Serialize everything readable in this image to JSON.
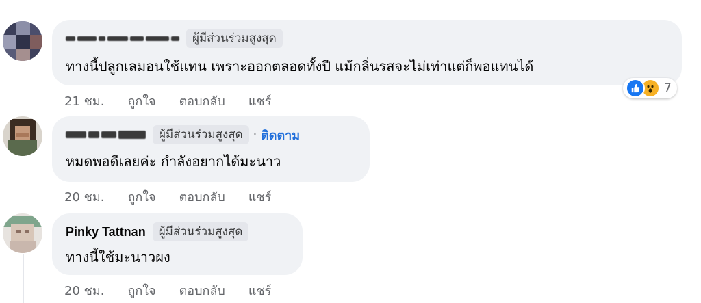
{
  "comments": [
    {
      "author_redacted": true,
      "badge": "ผู้มีส่วนร่วมสูงสุด",
      "text": "ทางนี้ปลูกเลมอนใช้แทน เพราะออกตลอดทั้งปี แม้กลิ่นรสจะไม่เท่าแต่ก็พอแทนได้",
      "time": "21 ชม.",
      "like": "ถูกใจ",
      "reply": "ตอบกลับ",
      "share": "แชร์",
      "reactions": {
        "icons": [
          "like-icon",
          "wow-icon"
        ],
        "count": "7"
      }
    },
    {
      "author_redacted": true,
      "badge": "ผู้มีส่วนร่วมสูงสุด",
      "separator": "·",
      "follow": "ติดตาม",
      "text": "หมดพอดีเลยค่ะ กำลังอยากได้มะนาว",
      "time": "20 ชม.",
      "like": "ถูกใจ",
      "reply": "ตอบกลับ",
      "share": "แชร์"
    },
    {
      "author": "Pinky Tattnan",
      "badge": "ผู้มีส่วนร่วมสูงสุด",
      "text": "ทางนี้ใช้มะนาวผง",
      "time": "20 ชม.",
      "like": "ถูกใจ",
      "reply": "ตอบกลับ",
      "share": "แชร์"
    }
  ],
  "colors": {
    "bubble": "#f0f2f5",
    "badge_bg": "#e4e6eb",
    "link": "#216fdb",
    "meta": "#65676b",
    "like_blue": "#1877f2",
    "wow_yellow": "#f7b125"
  }
}
